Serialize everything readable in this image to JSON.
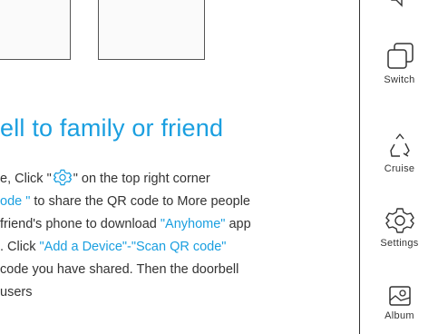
{
  "heading": "ell to family or friend",
  "instructions": [
    [
      {
        "text": "e, Click \"",
        "style": "normal"
      },
      {
        "icon": "gear-icon"
      },
      {
        "text": "\" on the top right corner",
        "style": "normal"
      }
    ],
    [
      {
        "text": "ode \"",
        "style": "blue"
      },
      {
        "text": " to share the QR code to More people",
        "style": "normal"
      }
    ],
    [
      {
        "text": " friend's phone to download ",
        "style": "normal"
      },
      {
        "text": "\"Anyhome\"",
        "style": "blue"
      },
      {
        "text": " app",
        "style": "normal"
      }
    ],
    [
      {
        "text": ". Click ",
        "style": "normal"
      },
      {
        "text": "\"Add a Device\"-\"Scan QR code\"",
        "style": "blue"
      }
    ],
    [
      {
        "text": "code you have shared. Then the doorbell",
        "style": "normal"
      }
    ],
    [
      {
        "text": "users",
        "style": "normal"
      }
    ]
  ],
  "sidebar": {
    "items": [
      {
        "label": "",
        "icon": "mute-icon"
      },
      {
        "label": "Switch",
        "icon": "switch-icon"
      },
      {
        "label": "Cruise",
        "icon": "cruise-icon"
      },
      {
        "label": "Settings",
        "icon": "settings-icon"
      },
      {
        "label": "Album",
        "icon": "album-icon"
      }
    ]
  },
  "colors": {
    "accent": "#1a9fe0",
    "text": "#333333",
    "border": "#333333"
  }
}
